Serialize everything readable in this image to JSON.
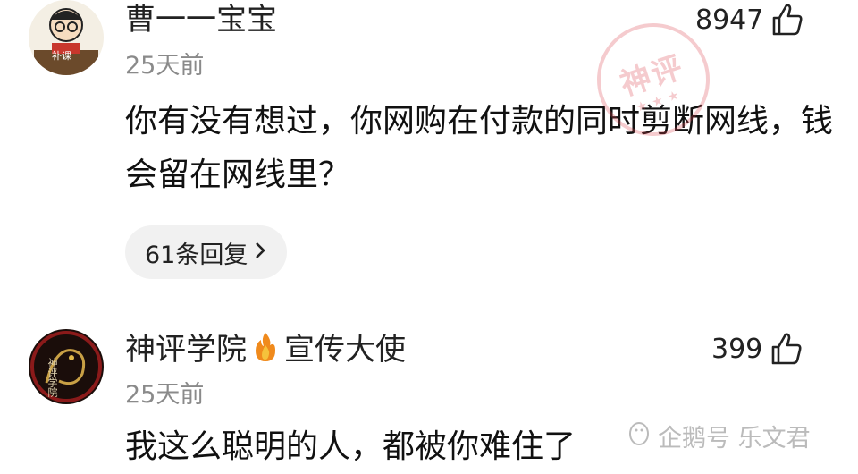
{
  "comments": [
    {
      "username": "曹一一宝宝",
      "time": "25天前",
      "likes": "8947",
      "body": "你有没有想过，你网购在付款的同时剪断网线，钱会留在网线里？",
      "replies": "61条回复",
      "avatar_label": "补课"
    },
    {
      "username_prefix": "神评学院",
      "badge_icon": "fire-icon",
      "username_suffix": "宣传大使",
      "time": "25天前",
      "likes": "399",
      "body": "我这么聪明的人，都被你难住了",
      "avatar_label": "神评学院"
    }
  ],
  "stamp": {
    "text": "神评",
    "stars": "★★★"
  },
  "watermark": "企鹅号 乐文君",
  "colors": {
    "muted": "#8a8a8a",
    "pill": "#f1f1f1",
    "stamp": "#dc4650"
  }
}
